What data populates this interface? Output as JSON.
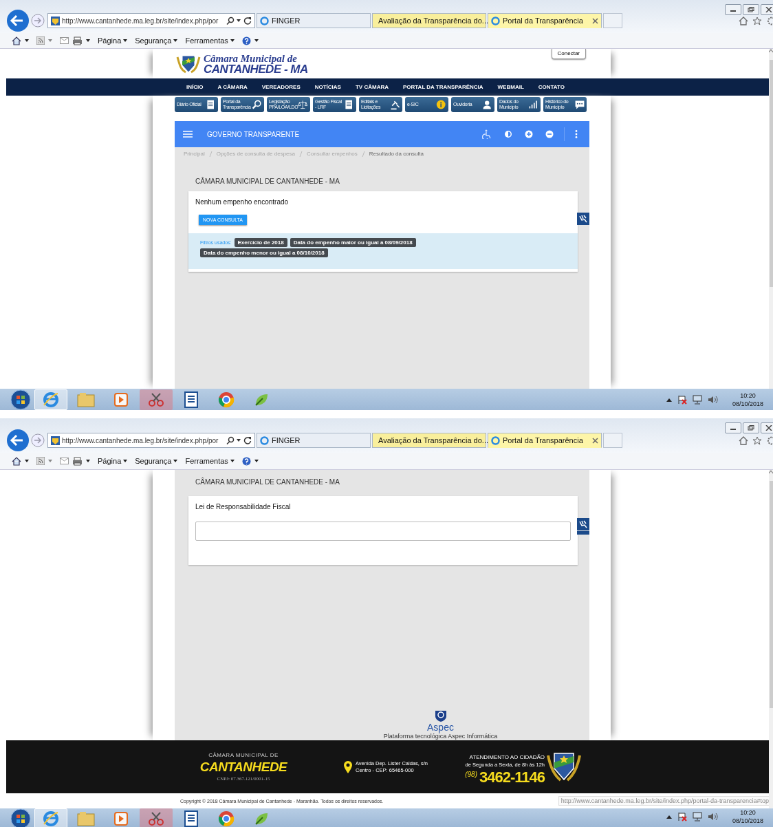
{
  "screens": [
    {
      "kind": "result",
      "browser": {
        "address": "http://www.cantanhede.ma.leg.br/site/index.php/por",
        "tabs": [
          {
            "label": "FINGER",
            "selected": false,
            "grouped": false
          },
          {
            "label": "Avaliação da Transparência do...",
            "selected": false,
            "grouped": true
          },
          {
            "label": "Portal da Transparência",
            "selected": true,
            "grouped": true
          }
        ],
        "menu": [
          "Página",
          "Segurança",
          "Ferramentas"
        ]
      },
      "site": {
        "title_line1": "Câmara Municipal de",
        "title_line2": "CANTANHEDE - MA",
        "connect": "Conectar",
        "nav": [
          "INÍCIO",
          "A CÂMARA",
          "VEREADORES",
          "NOTÍCIAS",
          "TV CÂMARA",
          "PORTAL DA TRANSPARÊNCIA",
          "WEBMAIL",
          "CONTATO"
        ],
        "quick_links": [
          "Diário Oficial",
          "Portal da Transparência",
          "Legislação PPA/LOA/LDO",
          "Gestão Fiscal - LRF",
          "Editais e Licitações",
          "e-SIC",
          "Ouvidoria",
          "Dados do Município",
          "Histórico do Município"
        ]
      },
      "panel": {
        "title": "GOVERNO TRANSPARENTE",
        "breadcrumb": [
          {
            "label": "Principal",
            "current": false
          },
          {
            "label": "Opções de consulta de despesa",
            "current": false
          },
          {
            "label": "Consultar empenhos",
            "current": false
          },
          {
            "label": "Resultado da consulta",
            "current": true
          }
        ],
        "heading": "CÂMARA MUNICIPAL DE CANTANHEDE - MA",
        "message": "Nenhum empenho encontrado",
        "button": "NOVA CONSULTA",
        "filters_label": "Filtros usados:",
        "filters": [
          "Exercício de 2018",
          "Data do empenho maior ou igual a 08/09/2018",
          "Data do empenho menor ou igual a 08/10/2018"
        ]
      },
      "taskbar": {
        "time": "10:20",
        "date": "08/10/2018"
      }
    },
    {
      "kind": "scrolled",
      "browser": {
        "address": "http://www.cantanhede.ma.leg.br/site/index.php/por",
        "tabs": [
          {
            "label": "FINGER",
            "selected": false,
            "grouped": false
          },
          {
            "label": "Avaliação da Transparência do...",
            "selected": false,
            "grouped": true
          },
          {
            "label": "Portal da Transparência",
            "selected": true,
            "grouped": true
          }
        ],
        "menu": [
          "Página",
          "Segurança",
          "Ferramentas"
        ]
      },
      "panel": {
        "heading": "CÂMARA MUNICIPAL DE CANTANHEDE - MA",
        "section": "Lei de Responsabilidade Fiscal",
        "platform_brand": "Aspec",
        "platform": "Plataforma tecnológica Aspec Informática"
      },
      "footer": {
        "org_line1": "CÂMARA MUNICIPAL DE",
        "org_line2": "CANTANHEDE",
        "cnpj": "CNPJ: 07.367.121/0001-15",
        "address_line1": "Avenida Dep. Lister Caldas, s/n",
        "address_line2": "Centro - CEP: 65465-000",
        "service_title": "ATENDIMENTO AO CIDADÃO",
        "service_hours": "de Segunda a Sexta, de 8h às 12h",
        "area_code": "(98)",
        "phone": "3462-1146",
        "copyright": "Copyright © 2018 Câmara Municipal de Cantanhede - Maranhão. Todos os direitos reservados.",
        "status_url": "http://www.cantanhede.ma.leg.br/site/index.php/portal-da-transparencia#top"
      },
      "taskbar": {
        "time": "10:20",
        "date": "08/10/2018"
      }
    }
  ]
}
